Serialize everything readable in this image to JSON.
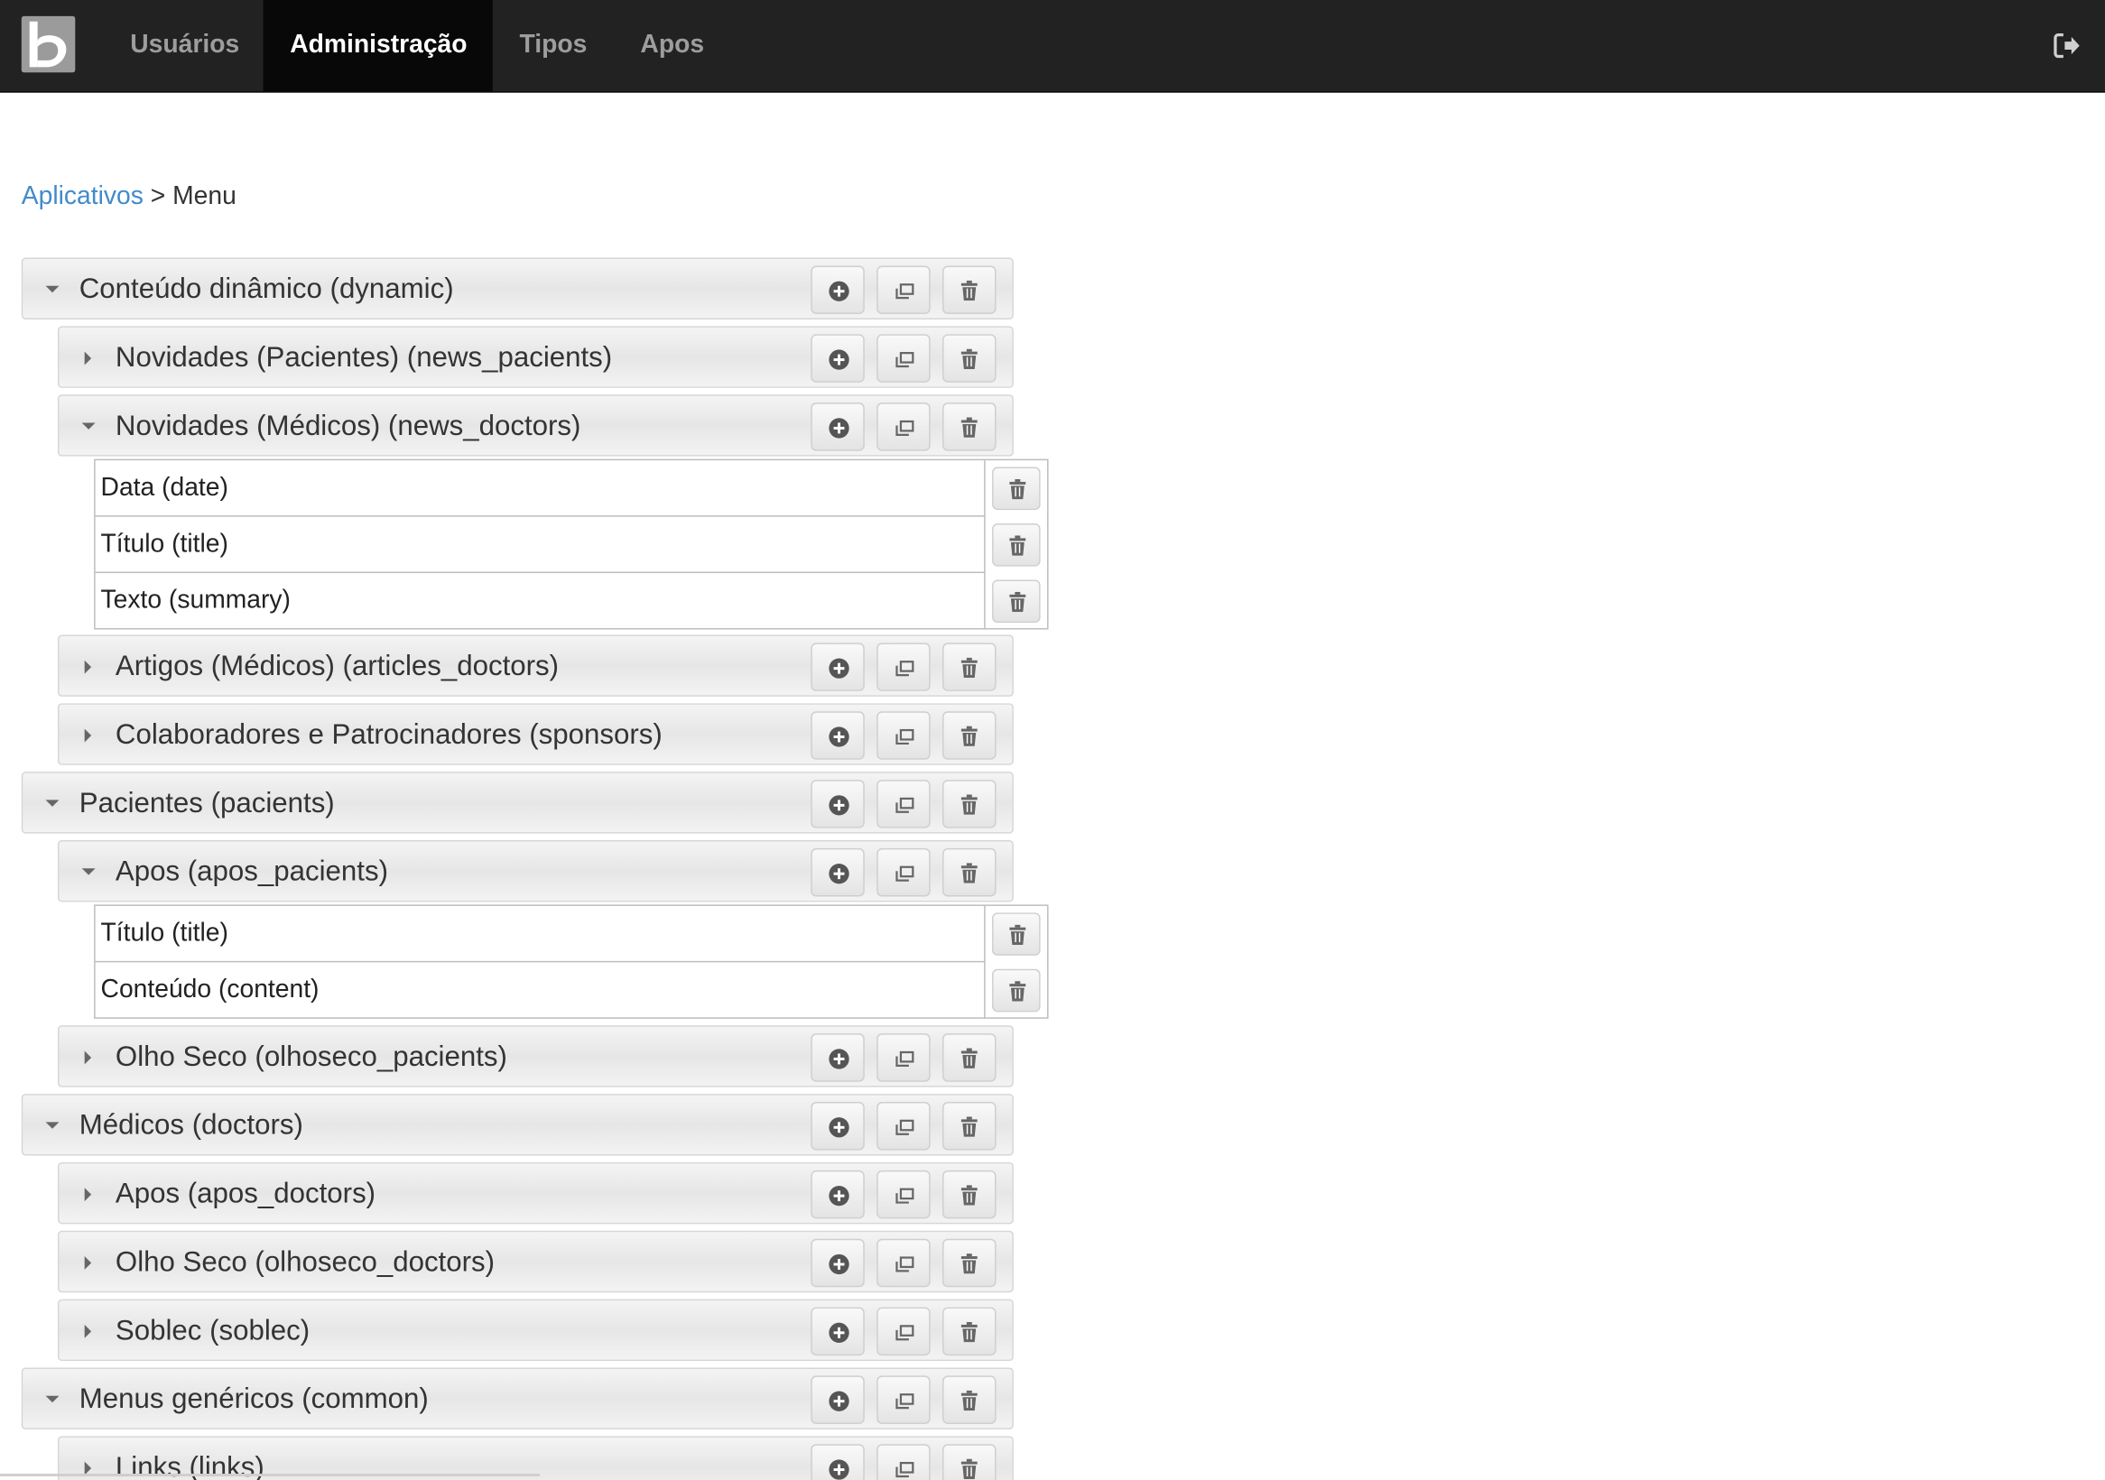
{
  "navbar": {
    "brand_letter": "b",
    "items": [
      {
        "label": "Usuários",
        "active": false
      },
      {
        "label": "Administração",
        "active": true
      },
      {
        "label": "Tipos",
        "active": false
      },
      {
        "label": "Apos",
        "active": false
      }
    ],
    "logout_icon": "sign-out-icon"
  },
  "breadcrumb": {
    "link": "Aplicativos",
    "separator": ">",
    "current": "Menu"
  },
  "tree": {
    "r0": {
      "label": "Conteúdo dinâmico (dynamic)",
      "expanded": true
    },
    "r1": {
      "label": "Novidades (Pacientes) (news_pacients)",
      "expanded": false
    },
    "r2": {
      "label": "Novidades (Médicos) (news_doctors)",
      "expanded": true
    },
    "f2": [
      "Data (date)",
      "Título (title)",
      "Texto (summary)"
    ],
    "r3": {
      "label": "Artigos (Médicos) (articles_doctors)",
      "expanded": false
    },
    "r4": {
      "label": "Colaboradores e Patrocinadores (sponsors)",
      "expanded": false
    },
    "r5": {
      "label": "Pacientes (pacients)",
      "expanded": true
    },
    "r6": {
      "label": "Apos (apos_pacients)",
      "expanded": true
    },
    "f6": [
      "Título (title)",
      "Conteúdo (content)"
    ],
    "r7": {
      "label": "Olho Seco (olhoseco_pacients)",
      "expanded": false
    },
    "r8": {
      "label": "Médicos (doctors)",
      "expanded": true
    },
    "r9": {
      "label": "Apos (apos_doctors)",
      "expanded": false
    },
    "r10": {
      "label": "Olho Seco (olhoseco_doctors)",
      "expanded": false
    },
    "r11": {
      "label": "Soblec (soblec)",
      "expanded": false
    },
    "r12": {
      "label": "Menus genéricos (common)",
      "expanded": true
    },
    "r13": {
      "label": "Links (links)",
      "expanded": false
    }
  },
  "icons": {
    "add": "plus-circle-icon",
    "copy": "copy-icon",
    "delete": "trash-icon"
  }
}
